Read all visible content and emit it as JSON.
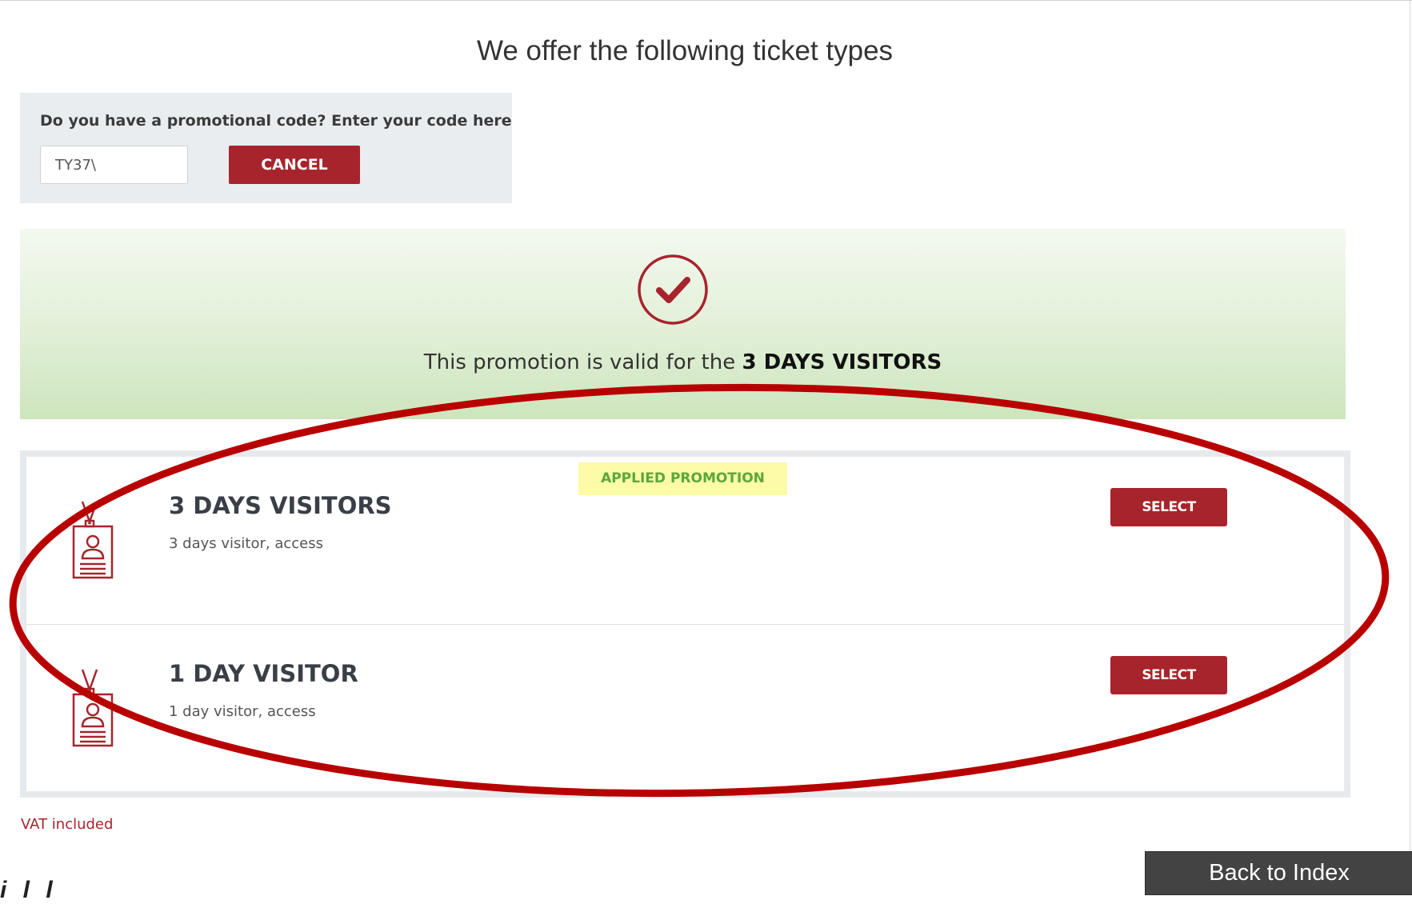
{
  "header": {
    "title": "We offer the following ticket types"
  },
  "promo": {
    "prompt": "Do you have a promotional code? Enter your code here",
    "code_value": "TY37\\",
    "cancel_label": "CANCEL"
  },
  "success": {
    "icon": "check-circle-icon",
    "message_prefix": "This promotion is valid for the ",
    "message_ticket": "3 DAYS VISITORS"
  },
  "tickets": [
    {
      "name": "3 DAYS VISITORS",
      "description": "3 days visitor, access",
      "badge": "APPLIED PROMOTION",
      "select_label": "SELECT",
      "icon": "id-badge-icon"
    },
    {
      "name": "1 DAY VISITOR",
      "description": "1 day visitor, access",
      "select_label": "SELECT",
      "icon": "id-badge-icon"
    }
  ],
  "footer": {
    "vat_note": "VAT included",
    "partial_text": "i    l    l    ",
    "back_label": "Back to Index"
  },
  "colors": {
    "brand_red": "#a8242c",
    "success_green": "#d7ead0",
    "badge_yellow": "#fdfaa8",
    "badge_text_green": "#5aa83a",
    "annotation_red": "#b80000"
  }
}
